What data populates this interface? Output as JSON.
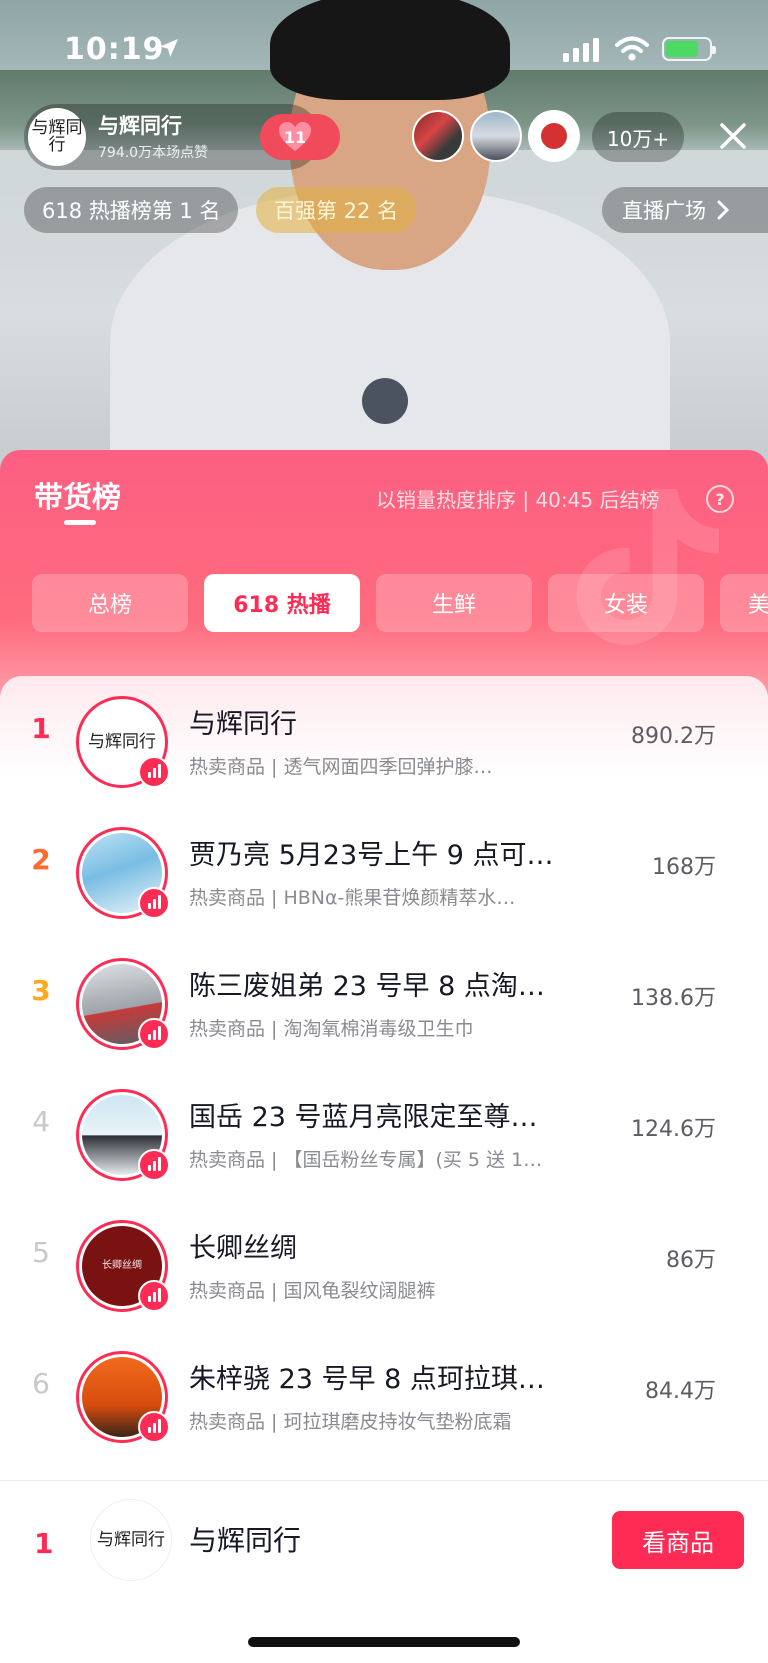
{
  "status_bar": {
    "time": "10:19"
  },
  "host": {
    "avatar_text": "与辉同行",
    "name": "与辉同行",
    "likes": "794.0万本场点赞",
    "fan_level": "11"
  },
  "viewers": {
    "count": "10万+"
  },
  "rank_pills": {
    "hot": "618 热播榜第 1 名",
    "top": "百强第 22 名",
    "square": "直播广场"
  },
  "panel": {
    "title": "带货榜",
    "subtitle": "以销量热度排序 | 40:45 后结榜",
    "help": "?"
  },
  "tabs": [
    {
      "label": "总榜"
    },
    {
      "label": "618 热播"
    },
    {
      "label": "生鲜"
    },
    {
      "label": "女装"
    },
    {
      "label": "美"
    }
  ],
  "rows": [
    {
      "rank": "1",
      "name": "与辉同行",
      "sub": "热卖商品 | 透气网面四季回弹护膝…",
      "value": "890.2万",
      "avatar_text": "与辉同行"
    },
    {
      "rank": "2",
      "name": "贾乃亮 5月23号上午 9 点可…",
      "sub": "热卖商品 | HBNα-熊果苷焕颜精萃水…",
      "value": "168万",
      "avatar_text": ""
    },
    {
      "rank": "3",
      "name": "陈三废姐弟 23 号早 8 点淘…",
      "sub": "热卖商品 | 淘淘氧棉消毒级卫生巾",
      "value": "138.6万",
      "avatar_text": ""
    },
    {
      "rank": "4",
      "name": "国岳 23 号蓝月亮限定至尊…",
      "sub": "热卖商品 | 【国岳粉丝专属】(买 5 送 1…",
      "value": "124.6万",
      "avatar_text": ""
    },
    {
      "rank": "5",
      "name": "长卿丝绸",
      "sub": "热卖商品 | 国风龟裂纹阔腿裤",
      "value": "86万",
      "avatar_text": "长卿丝绸"
    },
    {
      "rank": "6",
      "name": "朱梓骁 23 号早 8 点珂拉琪…",
      "sub": "热卖商品 | 珂拉琪磨皮持妆气垫粉底霜",
      "value": "84.4万",
      "avatar_text": ""
    }
  ],
  "bottom": {
    "rank": "1",
    "avatar_text": "与辉同行",
    "name": "与辉同行",
    "button": "看商品"
  },
  "colors": {
    "accent": "#fe2c55",
    "rank2": "#ff6b2d",
    "rank3": "#ffaa1c"
  }
}
